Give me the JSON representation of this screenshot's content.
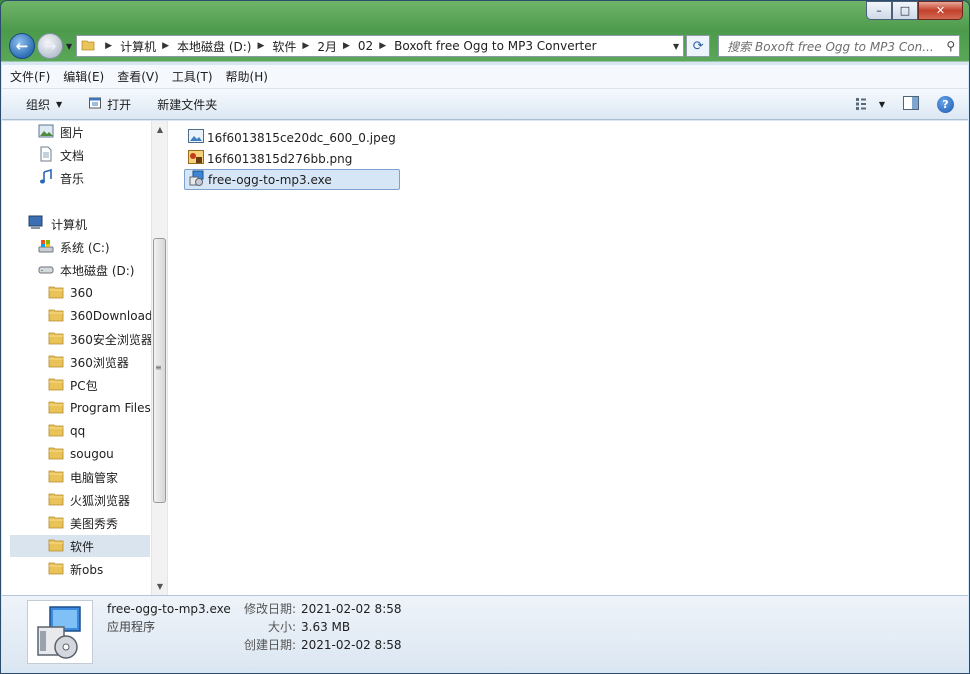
{
  "window": {
    "caption_buttons": {
      "minimize": "–",
      "maximize": "□",
      "close": "✕"
    }
  },
  "address": {
    "crumbs": [
      "计算机",
      "本地磁盘 (D:)",
      "软件",
      "2月",
      "02",
      "Boxoft free Ogg to MP3 Converter"
    ],
    "search_placeholder": "搜索 Boxoft free Ogg to MP3 Con..."
  },
  "menubar": [
    "文件(F)",
    "编辑(E)",
    "查看(V)",
    "工具(T)",
    "帮助(H)"
  ],
  "commands": {
    "organize": "组织",
    "open": "打开",
    "new_folder": "新建文件夹"
  },
  "nav": {
    "library": [
      "图片",
      "文档",
      "音乐"
    ],
    "computer": "计算机",
    "drives": [
      "系统 (C:)",
      "本地磁盘 (D:)"
    ],
    "folders": [
      "360",
      "360Download",
      "360安全浏览器",
      "360浏览器",
      "PC包",
      "Program Files",
      "qq",
      "sougou",
      "电脑管家",
      "火狐浏览器",
      "美图秀秀",
      "软件",
      "新obs"
    ],
    "selected_folder": "软件"
  },
  "files": [
    {
      "name": "16f6013815ce20dc_600_0.jpeg",
      "icon": "jpeg-image-icon"
    },
    {
      "name": "16f6013815d276bb.png",
      "icon": "png-image-icon"
    },
    {
      "name": "free-ogg-to-mp3.exe",
      "icon": "installer-exe-icon",
      "selected": true
    }
  ],
  "details": {
    "name": "free-ogg-to-mp3.exe",
    "type": "应用程序",
    "labels": [
      "修改日期:",
      "大小:",
      "创建日期:"
    ],
    "values": [
      "2021-02-02 8:58",
      "3.63 MB",
      "2021-02-02 8:58"
    ]
  }
}
